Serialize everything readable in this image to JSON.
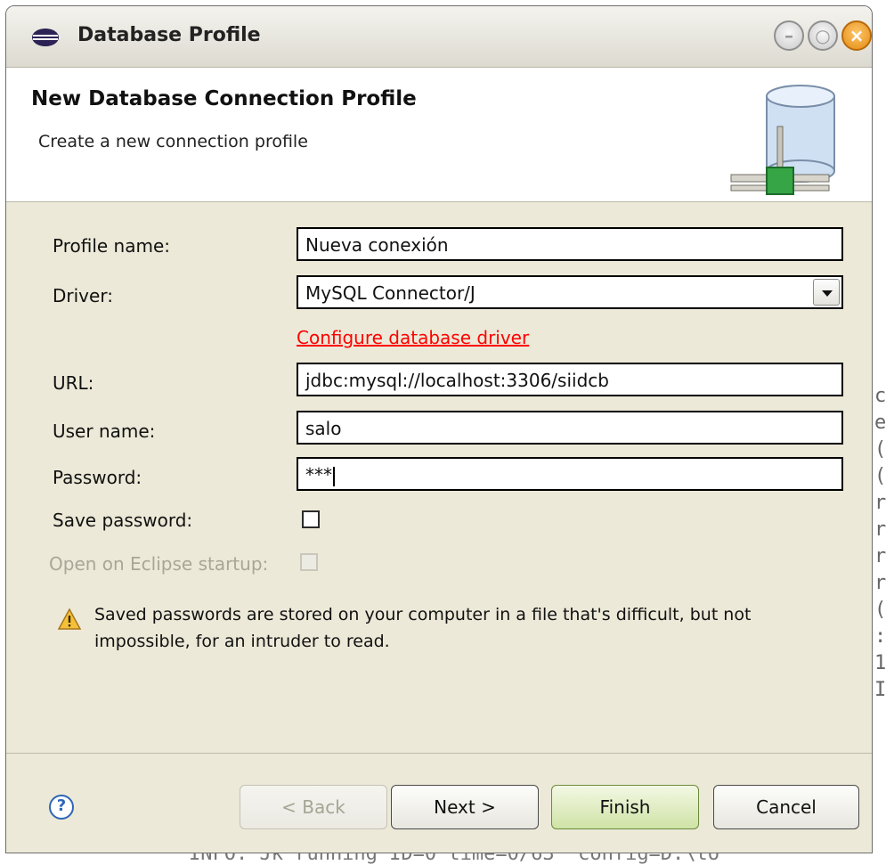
{
  "window": {
    "title": "Database Profile"
  },
  "header": {
    "title": "New Database Connection Profile",
    "description": "Create a new connection profile"
  },
  "form": {
    "profile_name_label": "Profile name:",
    "profile_name_value": "Nueva conexión",
    "driver_label": "Driver:",
    "driver_value": "MySQL Connector/J",
    "configure_link": "Configure database driver",
    "url_label": "URL:",
    "url_value": "jdbc:mysql://localhost:3306/siidcb",
    "username_label": "User name:",
    "username_value": "salo",
    "password_label": "Password:",
    "password_value": "***",
    "save_password_label": "Save password:",
    "save_password_checked": false,
    "open_on_startup_label": "Open on Eclipse startup:",
    "open_on_startup_checked": false
  },
  "warning": {
    "text": "Saved passwords are stored on your computer in a file that's difficult, but not impossible, for an intruder to read."
  },
  "buttons": {
    "help": "?",
    "back": "< Back",
    "next": "Next >",
    "finish": "Finish",
    "cancel": "Cancel"
  },
  "background": {
    "bottom_line": "INFO: Jk running ID=0 time=0/63  config=D:\\to",
    "side_chars": "c\ne\n(\n(\nr\nr\nr\nr\n(\n:\n1\nI"
  }
}
